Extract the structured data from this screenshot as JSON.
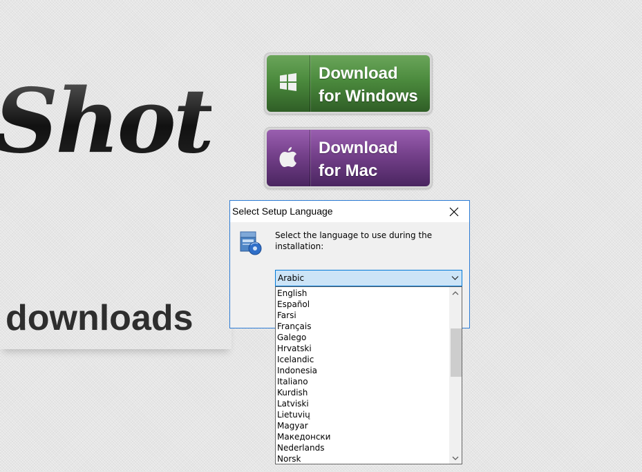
{
  "page": {
    "logo_text": "Shot",
    "section_heading": "downloads"
  },
  "download_buttons": {
    "windows": {
      "line1": "Download",
      "line2": "for Windows",
      "icon": "windows-logo-icon",
      "color": "#4b8a3d"
    },
    "mac": {
      "line1": "Download",
      "line2": "for Mac",
      "icon": "apple-logo-icon",
      "color": "#74408a"
    }
  },
  "dialog": {
    "title": "Select Setup Language",
    "prompt": "Select the language to use during the installation:",
    "selected_language": "Arabic",
    "languages": [
      "English",
      "Español",
      "Farsi",
      "Français",
      "Galego",
      "Hrvatski",
      "Icelandic",
      "Indonesia",
      "Italiano",
      "Kurdish",
      "Latviski",
      "Lietuvių",
      "Magyar",
      "Македонски",
      "Nederlands",
      "Norsk"
    ],
    "accent_color": "#0078d7"
  }
}
